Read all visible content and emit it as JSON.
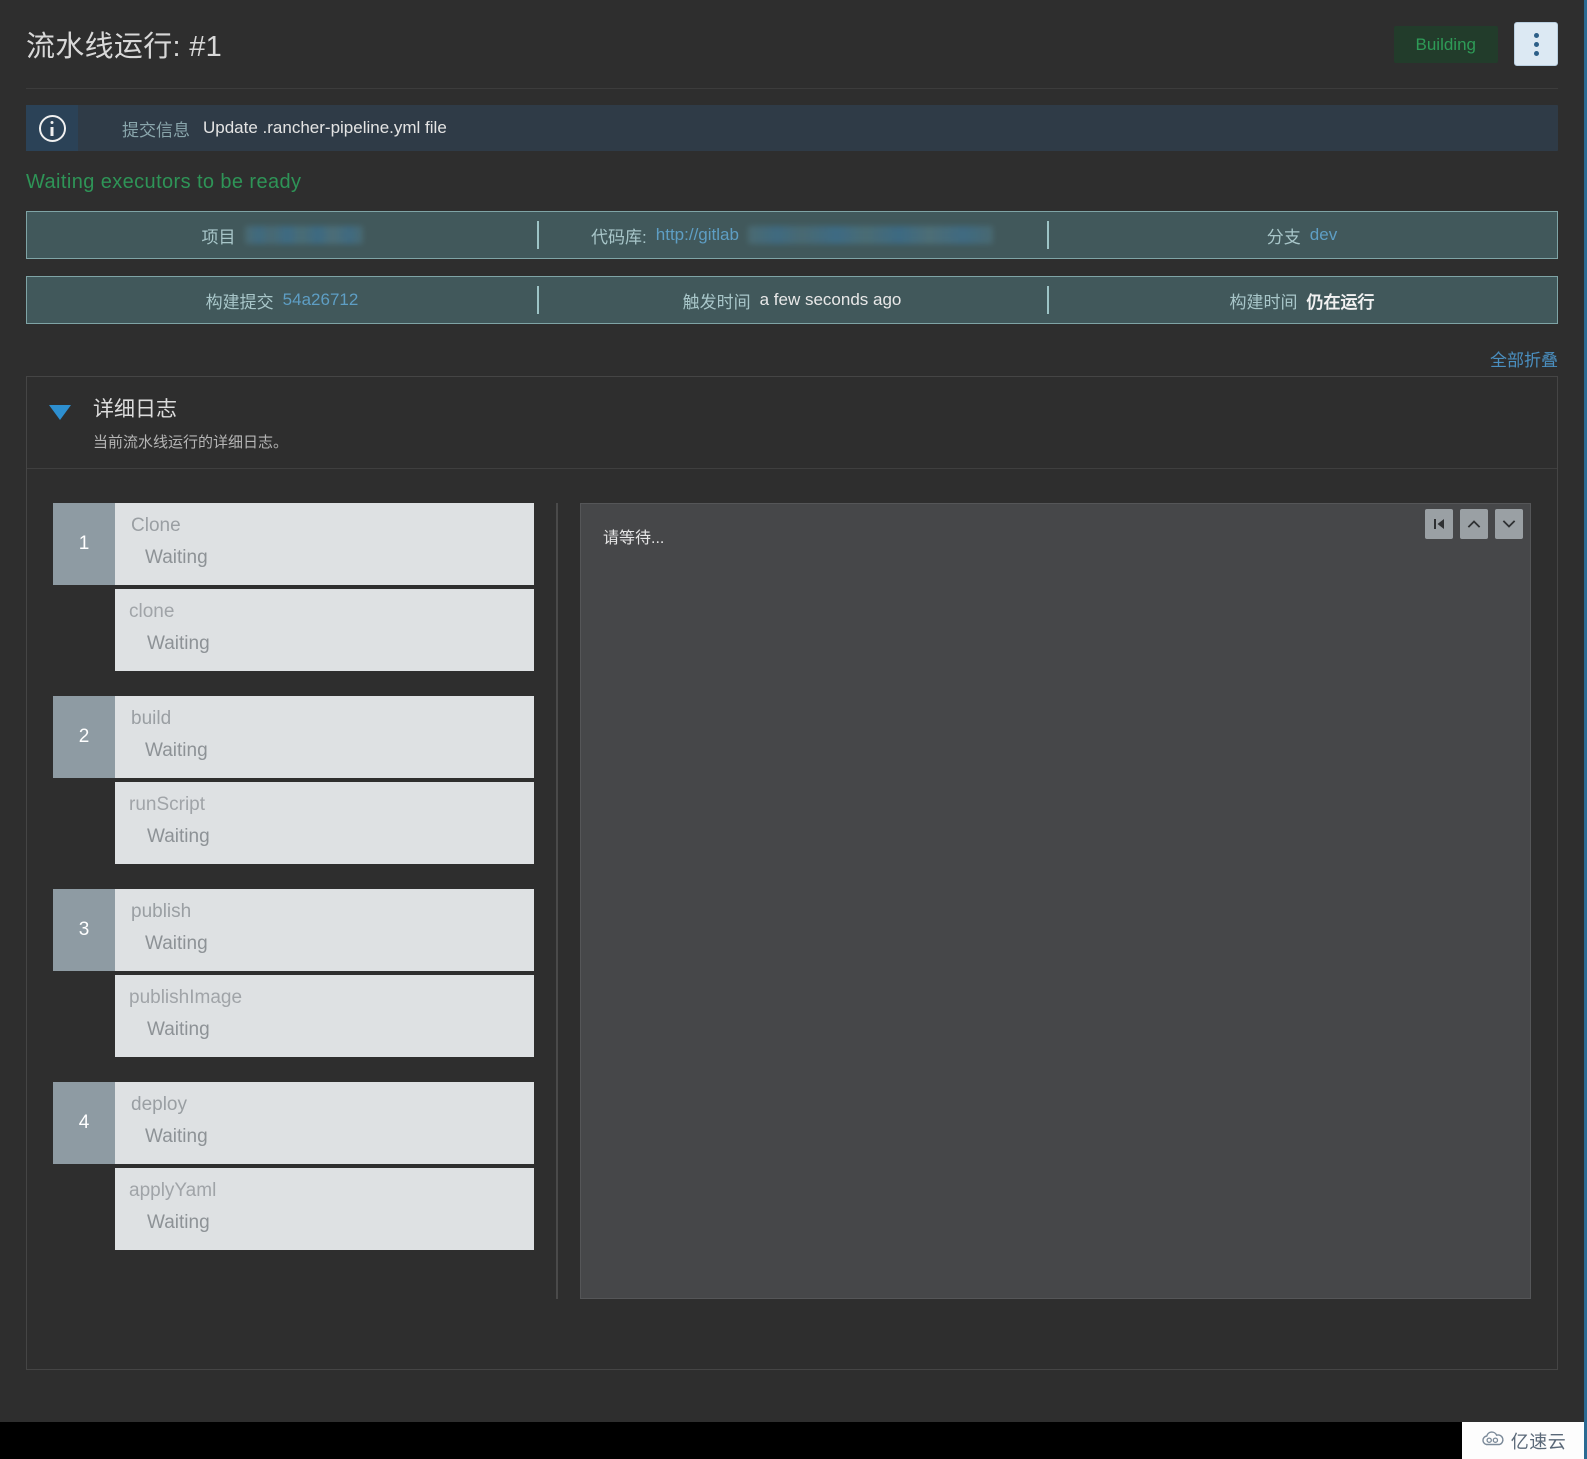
{
  "header": {
    "title": "流水线运行: #1",
    "status_badge": "Building",
    "menu_icon": "kebab-vertical-icon"
  },
  "info_banner": {
    "icon": "info-circle-icon",
    "label": "提交信息",
    "value": "Update .rancher-pipeline.yml file"
  },
  "status_line": "Waiting executors to be ready",
  "meta_rows": [
    [
      {
        "key": "项目",
        "value": "",
        "redacted": true,
        "kind": "plain"
      },
      {
        "key": "代码库:",
        "value": "http://gitlab",
        "redacted": true,
        "kind": "link"
      },
      {
        "key": "分支",
        "value": "dev",
        "redacted": false,
        "kind": "link"
      }
    ],
    [
      {
        "key": "构建提交",
        "value": "54a26712",
        "redacted": false,
        "kind": "link"
      },
      {
        "key": "触发时间",
        "value": "a few seconds ago",
        "redacted": false,
        "kind": "plain"
      },
      {
        "key": "构建时间",
        "value": "仍在运行",
        "redacted": false,
        "kind": "strong"
      }
    ]
  ],
  "collapse_all_label": "全部折叠",
  "detail": {
    "title": "详细日志",
    "subtitle": "当前流水线运行的详细日志。",
    "caret_icon": "caret-down-icon"
  },
  "stages": [
    {
      "number": "1",
      "name": "Clone",
      "status": "Waiting",
      "sub": {
        "name": "clone",
        "status": "Waiting"
      }
    },
    {
      "number": "2",
      "name": "build",
      "status": "Waiting",
      "sub": {
        "name": "runScript",
        "status": "Waiting"
      }
    },
    {
      "number": "3",
      "name": "publish",
      "status": "Waiting",
      "sub": {
        "name": "publishImage",
        "status": "Waiting"
      }
    },
    {
      "number": "4",
      "name": "deploy",
      "status": "Waiting",
      "sub": {
        "name": "applyYaml",
        "status": "Waiting"
      }
    }
  ],
  "log": {
    "content": "请等待...",
    "controls": [
      {
        "icon": "jump-to-start-icon",
        "name": "log-jump-start-button"
      },
      {
        "icon": "chevron-up-icon",
        "name": "log-scroll-up-button"
      },
      {
        "icon": "chevron-down-icon",
        "name": "log-scroll-down-button"
      }
    ]
  },
  "watermark": {
    "icon": "cloud-logo-icon",
    "text": "亿速云"
  },
  "colors": {
    "page_bg": "#2e2e2e",
    "accent_link": "#4a8fc0",
    "status_green": "#2e9457",
    "badge_bg": "#223c2b",
    "meta_bar_bg": "#41585b",
    "meta_bar_border": "#7fa4a6",
    "step_card_bg": "#dee1e3",
    "step_num_bg": "#8e9ba3",
    "log_bg": "#464749"
  }
}
